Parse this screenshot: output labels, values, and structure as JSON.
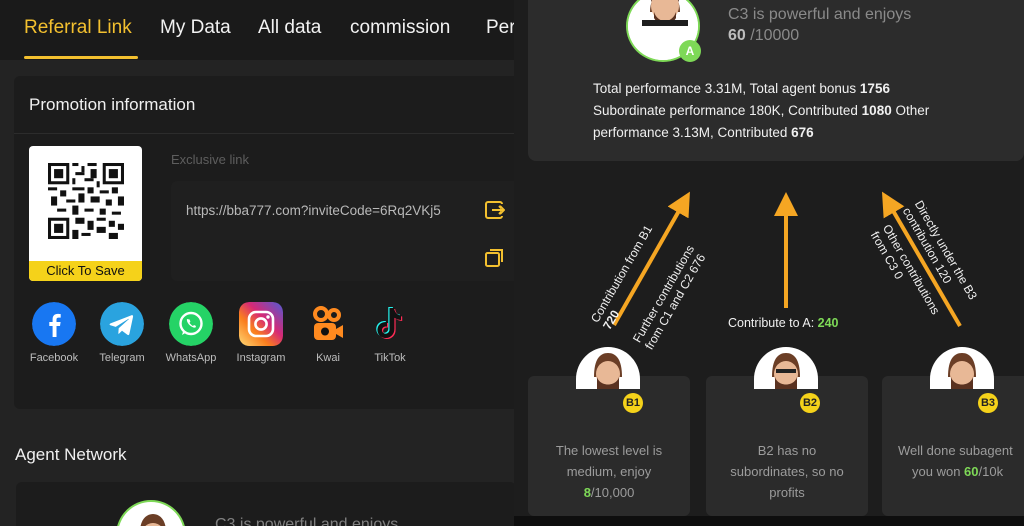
{
  "tabs": [
    {
      "label": "Referral Link",
      "active": true
    },
    {
      "label": "My Data"
    },
    {
      "label": "All data"
    },
    {
      "label": "commission"
    },
    {
      "label": "Per"
    }
  ],
  "promotion": {
    "title": "Promotion information",
    "qr_save_label": "Click To Save",
    "exclusive_label": "Exclusive link",
    "link": "https://bba777.com?inviteCode=6Rq2VKj5",
    "open_icon": "share-out-icon",
    "copy_icon": "copy-icon"
  },
  "social": [
    {
      "label": "Facebook",
      "icon": "facebook-icon",
      "color": "#1877F2"
    },
    {
      "label": "Telegram",
      "icon": "telegram-icon",
      "color": "#2AA3DF"
    },
    {
      "label": "WhatsApp",
      "icon": "whatsapp-icon",
      "color": "#25D366"
    },
    {
      "label": "Instagram",
      "icon": "instagram-icon",
      "color": "#E1306C"
    },
    {
      "label": "Kwai",
      "icon": "kwai-icon",
      "color": "#FF8A1F"
    },
    {
      "label": "TikTok",
      "icon": "tiktok-icon",
      "color": "#111111"
    }
  ],
  "agent_network": {
    "title": "Agent Network",
    "partial_text": "C3 is powerful and enjoys"
  },
  "right": {
    "badge_a": "A",
    "c3_title": "C3 is powerful and enjoys",
    "c3_value": "60",
    "c3_total": " /10000",
    "perf": {
      "p1": "Total performance 3.31M, Total agent bonus ",
      "p1_b": "1756",
      "p2": "Subordinate performance 180K, Contributed ",
      "p2_b": "1080",
      "p3": " Other performance 3.13M, Contributed ",
      "p3_b": "676"
    },
    "arrow_labels": {
      "b1_a": "Contribution from B1",
      "b1_b": "720",
      "b1_c": "Further contributions",
      "b1_d": "from C1 and C2 676",
      "contrib_a": "Contribute to A: ",
      "contrib_a_val": "240",
      "b3_a": "Directly under the B3",
      "b3_b": "contribution 120",
      "b3_c": "Other contributions",
      "b3_d": "from C3 0"
    },
    "b_cards": [
      {
        "badge": "B1",
        "line1": "The lowest level is",
        "line2": "medium, enjoy",
        "val": "8",
        "total": "/10,000"
      },
      {
        "badge": "B2",
        "line1": "B2 has no",
        "line2": "subordinates, so no",
        "line3": "profits"
      },
      {
        "badge": "B3",
        "line1": "Well done subagent",
        "line2a": "you won ",
        "val": "60",
        "total": "/10k"
      }
    ],
    "accent_green": "#7ED957",
    "accent_yellow": "#F5D21A",
    "arrow_color": "#F5A623"
  }
}
